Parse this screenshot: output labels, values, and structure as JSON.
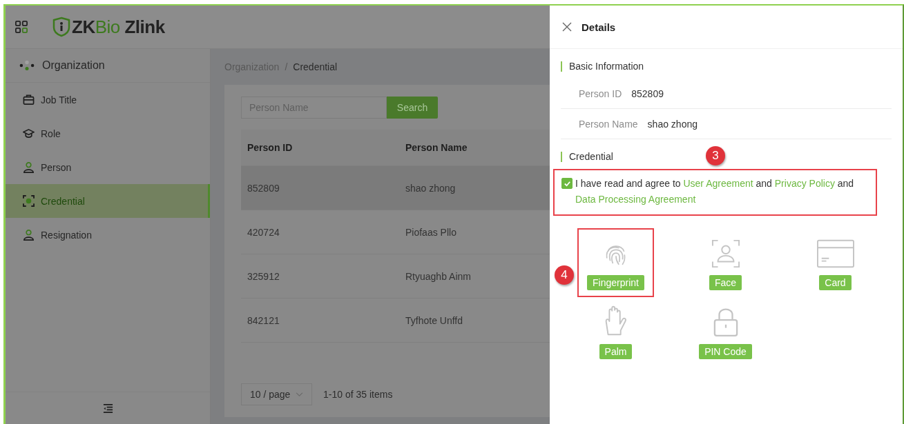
{
  "header": {
    "logo": {
      "brand": "ZK",
      "brand_accent": "Bio",
      "product": "Zlink"
    }
  },
  "sidebar": {
    "items": [
      {
        "label": "Organization",
        "kind": "org",
        "selected": false
      },
      {
        "label": "Job Title",
        "kind": "briefcase",
        "selected": false
      },
      {
        "label": "Role",
        "kind": "cap",
        "selected": false
      },
      {
        "label": "Person",
        "kind": "person",
        "selected": false
      },
      {
        "label": "Credential",
        "kind": "scan",
        "selected": true
      },
      {
        "label": "Resignation",
        "kind": "person",
        "selected": false
      }
    ]
  },
  "breadcrumb": {
    "separator": "/",
    "items": [
      {
        "label": "Organization",
        "current": false
      },
      {
        "label": "Credential",
        "current": true
      }
    ]
  },
  "search": {
    "placeholder": "Person Name",
    "button": "Search"
  },
  "table": {
    "columns": [
      "Person ID",
      "Person Name"
    ],
    "rows": [
      {
        "cells": [
          "852809",
          "shao zhong"
        ],
        "hovered": true
      },
      {
        "cells": [
          "420724",
          "Piofaas Pllo"
        ],
        "hovered": false
      },
      {
        "cells": [
          "325912",
          "Rtyuaghb Ainm"
        ],
        "hovered": false
      },
      {
        "cells": [
          "842121",
          "Tyfhote Unffd"
        ],
        "hovered": false
      }
    ]
  },
  "pagination": {
    "page_size": "10 / page",
    "total": "1-10 of 35 items"
  },
  "drawer": {
    "title": "Details",
    "basic": {
      "title": "Basic Information",
      "fields": [
        {
          "label": "Person ID",
          "value": "852809"
        },
        {
          "label": "Person Name",
          "value": "shao zhong"
        }
      ]
    },
    "credential": {
      "title": "Credential",
      "agreement": {
        "checked": true,
        "highlighted": true,
        "marker": "3",
        "parts": [
          {
            "kind": "text",
            "text": "I have read and agree to"
          },
          {
            "kind": "link",
            "text": "User Agreement"
          },
          {
            "kind": "text",
            "text": "and"
          },
          {
            "kind": "link",
            "text": "Privacy Policy"
          },
          {
            "kind": "text",
            "text": "and"
          },
          {
            "kind": "link",
            "text": "Data Processing Agreement"
          }
        ]
      },
      "methods": [
        {
          "label": "Fingerprint",
          "kind": "fingerprint",
          "highlighted": true,
          "marker": "4"
        },
        {
          "label": "Face",
          "kind": "face",
          "highlighted": false
        },
        {
          "label": "Card",
          "kind": "card",
          "highlighted": false
        },
        {
          "label": "Palm",
          "kind": "palm",
          "highlighted": false
        },
        {
          "label": "PIN Code",
          "kind": "lock",
          "highlighted": false
        }
      ]
    }
  }
}
